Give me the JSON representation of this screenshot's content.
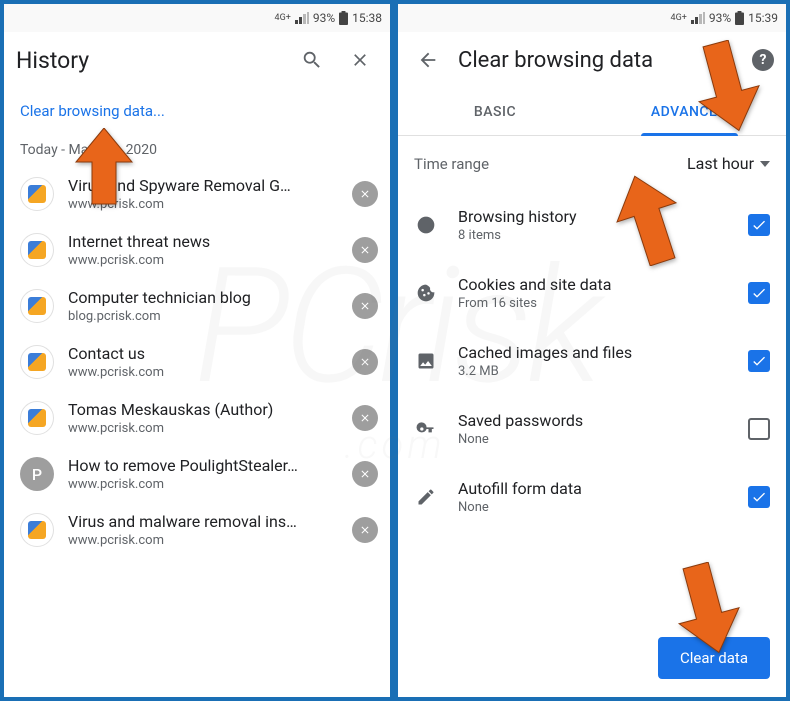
{
  "left": {
    "status": {
      "network": "4G+",
      "battery": "93%",
      "time": "15:38"
    },
    "header": {
      "title": "History"
    },
    "clear_link": "Clear browsing data...",
    "section_header": "Today - March 9, 2020",
    "items": [
      {
        "title": "Virus and Spyware Removal G…",
        "url": "www.pcrisk.com",
        "fav": "pcrisk"
      },
      {
        "title": "Internet threat news",
        "url": "www.pcrisk.com",
        "fav": "pcrisk"
      },
      {
        "title": "Computer technician blog",
        "url": "blog.pcrisk.com",
        "fav": "pcrisk"
      },
      {
        "title": "Contact us",
        "url": "www.pcrisk.com",
        "fav": "pcrisk"
      },
      {
        "title": "Tomas Meskauskas (Author)",
        "url": "www.pcrisk.com",
        "fav": "pcrisk"
      },
      {
        "title": "How to remove PoulightStealer…",
        "url": "www.pcrisk.com",
        "fav": "letter"
      },
      {
        "title": "Virus and malware removal ins…",
        "url": "www.pcrisk.com",
        "fav": "pcrisk"
      }
    ]
  },
  "right": {
    "status": {
      "network": "4G+",
      "battery": "93%",
      "time": "15:39"
    },
    "header": {
      "title": "Clear browsing data"
    },
    "tabs": {
      "basic": "BASIC",
      "advanced": "ADVANCED"
    },
    "time_range": {
      "label": "Time range",
      "value": "Last hour"
    },
    "options": [
      {
        "icon": "clock",
        "title": "Browsing history",
        "sub": "8 items",
        "checked": true
      },
      {
        "icon": "cookie",
        "title": "Cookies and site data",
        "sub": "From 16 sites",
        "checked": true
      },
      {
        "icon": "image",
        "title": "Cached images and files",
        "sub": "3.2 MB",
        "checked": true
      },
      {
        "icon": "key",
        "title": "Saved passwords",
        "sub": "None",
        "checked": false
      },
      {
        "icon": "pencil",
        "title": "Autofill form data",
        "sub": "None",
        "checked": true
      }
    ],
    "clear_button": "Clear data"
  },
  "watermark": {
    "main": "PCrisk",
    "sub": ".com"
  }
}
